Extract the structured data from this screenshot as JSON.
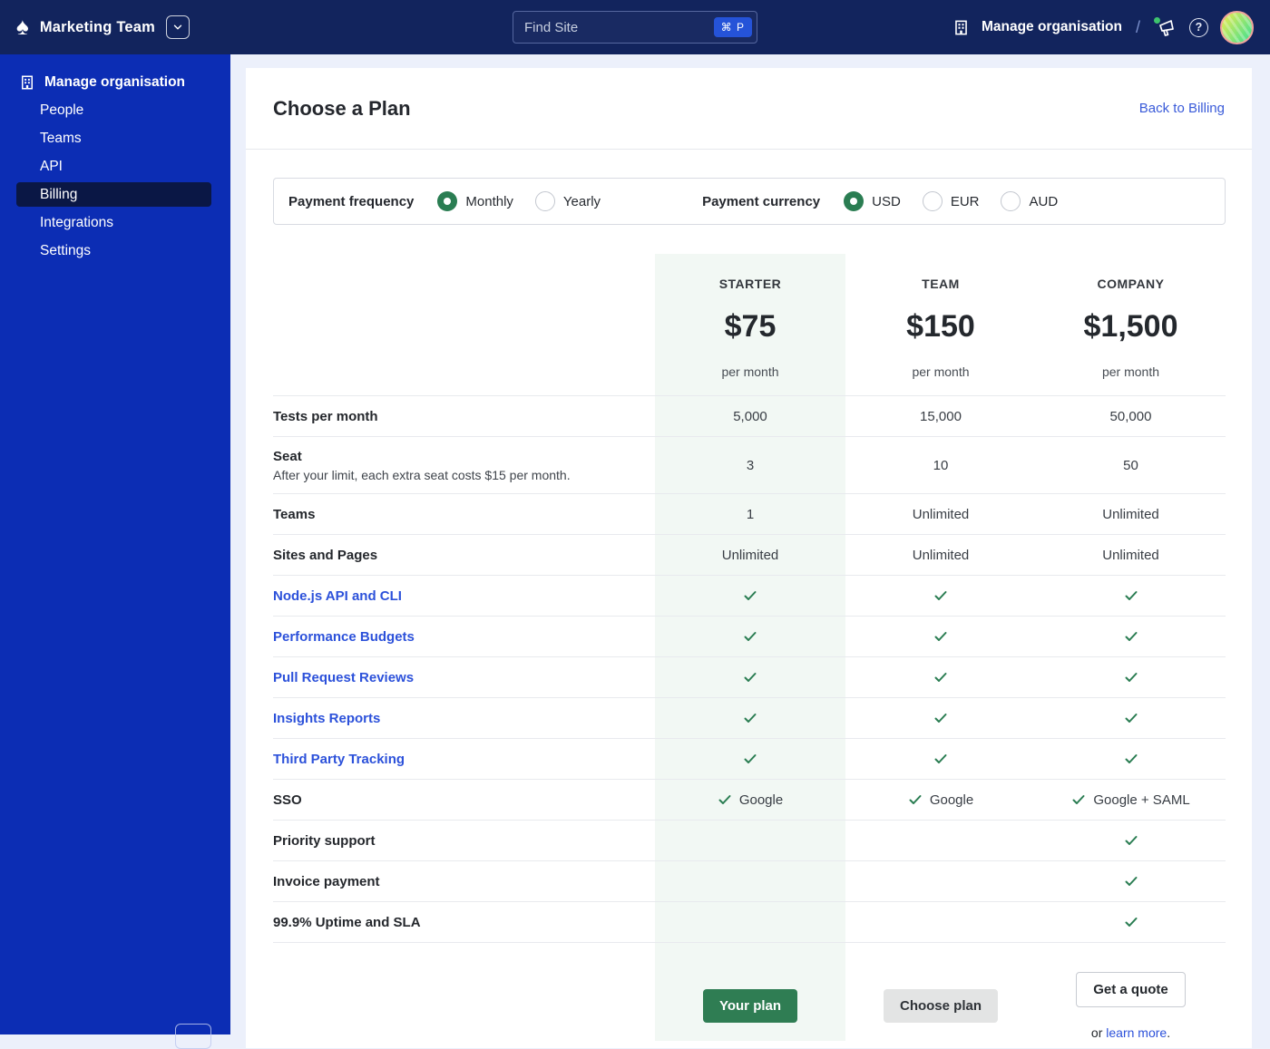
{
  "topbar": {
    "team_name": "Marketing Team",
    "search": {
      "placeholder": "Find Site",
      "shortcut": "⌘ P"
    },
    "manage_org": "Manage organisation"
  },
  "sidebar": {
    "header": "Manage organisation",
    "items": [
      {
        "label": "People",
        "selected": false
      },
      {
        "label": "Teams",
        "selected": false
      },
      {
        "label": "API",
        "selected": false
      },
      {
        "label": "Billing",
        "selected": true
      },
      {
        "label": "Integrations",
        "selected": false
      },
      {
        "label": "Settings",
        "selected": false
      }
    ]
  },
  "main": {
    "title": "Choose a Plan",
    "back_link": "Back to Billing",
    "options": {
      "frequency_label": "Payment frequency",
      "frequency_options": [
        {
          "label": "Monthly",
          "selected": true
        },
        {
          "label": "Yearly",
          "selected": false
        }
      ],
      "currency_label": "Payment currency",
      "currency_options": [
        {
          "label": "USD",
          "selected": true
        },
        {
          "label": "EUR",
          "selected": false
        },
        {
          "label": "AUD",
          "selected": false
        }
      ]
    },
    "plans": [
      {
        "name": "STARTER",
        "price": "$75",
        "period": "per month",
        "cta": "Your plan",
        "cta_style": "primary",
        "highlight": true
      },
      {
        "name": "TEAM",
        "price": "$150",
        "period": "per month",
        "cta": "Choose plan",
        "cta_style": "secondary",
        "highlight": false
      },
      {
        "name": "COMPANY",
        "price": "$1,500",
        "period": "per month",
        "cta": "Get a quote",
        "cta_style": "outline",
        "highlight": false,
        "cta_note": {
          "pre": "or ",
          "link": "learn more",
          "post": "."
        }
      }
    ],
    "rows": [
      {
        "label": "Tests per month",
        "values": [
          "5,000",
          "15,000",
          "50,000"
        ]
      },
      {
        "label": "Seat",
        "sublabel": "After your limit, each extra seat costs $15 per month.",
        "values": [
          "3",
          "10",
          "50"
        ]
      },
      {
        "label": "Teams",
        "values": [
          "1",
          "Unlimited",
          "Unlimited"
        ]
      },
      {
        "label": "Sites and Pages",
        "values": [
          "Unlimited",
          "Unlimited",
          "Unlimited"
        ]
      },
      {
        "label": "Node.js API and CLI",
        "link": true,
        "values": [
          {
            "check": true
          },
          {
            "check": true
          },
          {
            "check": true
          }
        ]
      },
      {
        "label": "Performance Budgets",
        "link": true,
        "values": [
          {
            "check": true
          },
          {
            "check": true
          },
          {
            "check": true
          }
        ]
      },
      {
        "label": "Pull Request Reviews",
        "link": true,
        "values": [
          {
            "check": true
          },
          {
            "check": true
          },
          {
            "check": true
          }
        ]
      },
      {
        "label": "Insights Reports",
        "link": true,
        "values": [
          {
            "check": true
          },
          {
            "check": true
          },
          {
            "check": true
          }
        ]
      },
      {
        "label": "Third Party Tracking",
        "link": true,
        "values": [
          {
            "check": true
          },
          {
            "check": true
          },
          {
            "check": true
          }
        ]
      },
      {
        "label": "SSO",
        "values": [
          {
            "check": true,
            "text": "Google"
          },
          {
            "check": true,
            "text": "Google"
          },
          {
            "check": true,
            "text": "Google + SAML"
          }
        ]
      },
      {
        "label": "Priority support",
        "values": [
          "",
          "",
          {
            "check": true
          }
        ]
      },
      {
        "label": "Invoice payment",
        "values": [
          "",
          "",
          {
            "check": true
          }
        ]
      },
      {
        "label": "99.9% Uptime and SLA",
        "values": [
          "",
          "",
          {
            "check": true
          }
        ]
      }
    ]
  },
  "colors": {
    "accent_green": "#2A7D52",
    "link_blue": "#2C51DA",
    "sidebar_blue": "#0C2DB4",
    "topbar_navy": "#12245D",
    "highlight_mint": "#F2F8F4"
  }
}
